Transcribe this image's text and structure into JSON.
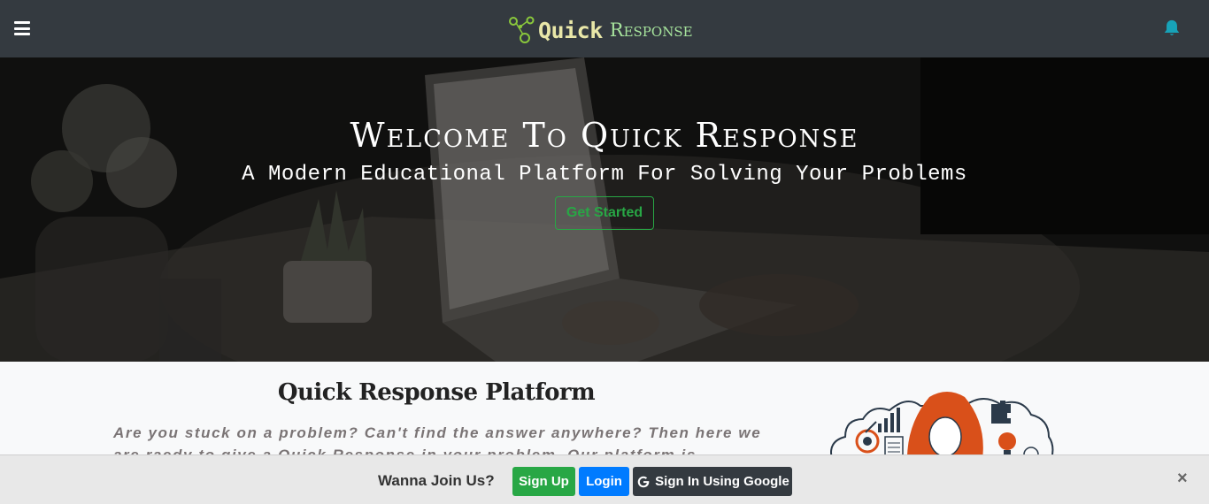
{
  "navbar": {
    "menu_icon": "hamburger-icon",
    "brand_logo_icon": "molecule-icon",
    "brand_part1": "Quick",
    "brand_part2": "Response",
    "bell_icon": "bell-icon"
  },
  "hero": {
    "title": "Welcome To Quick Response",
    "subtitle": "A Modern Educational Platform For Solving Your Problems",
    "cta_label": "Get Started"
  },
  "content": {
    "title": "Quick Response Platform",
    "text": "Are you stuck on a problem? Can't find the answer anywhere? Then here we are raedy to give a Quick Response in your problem. Our platform is"
  },
  "join_bar": {
    "prompt": "Wanna Join Us?",
    "signup_label": "Sign Up",
    "login_label": "Login",
    "google_label": "Sign In Using Google",
    "close_label": "×"
  },
  "colors": {
    "navbar_bg": "#343a40",
    "brand_quick": "#e9e7a8",
    "brand_response": "#a6e39c",
    "accent_green": "#28a745",
    "accent_blue": "#007bff",
    "bell": "#17a2b8",
    "illustration_orange": "#d9501a"
  }
}
